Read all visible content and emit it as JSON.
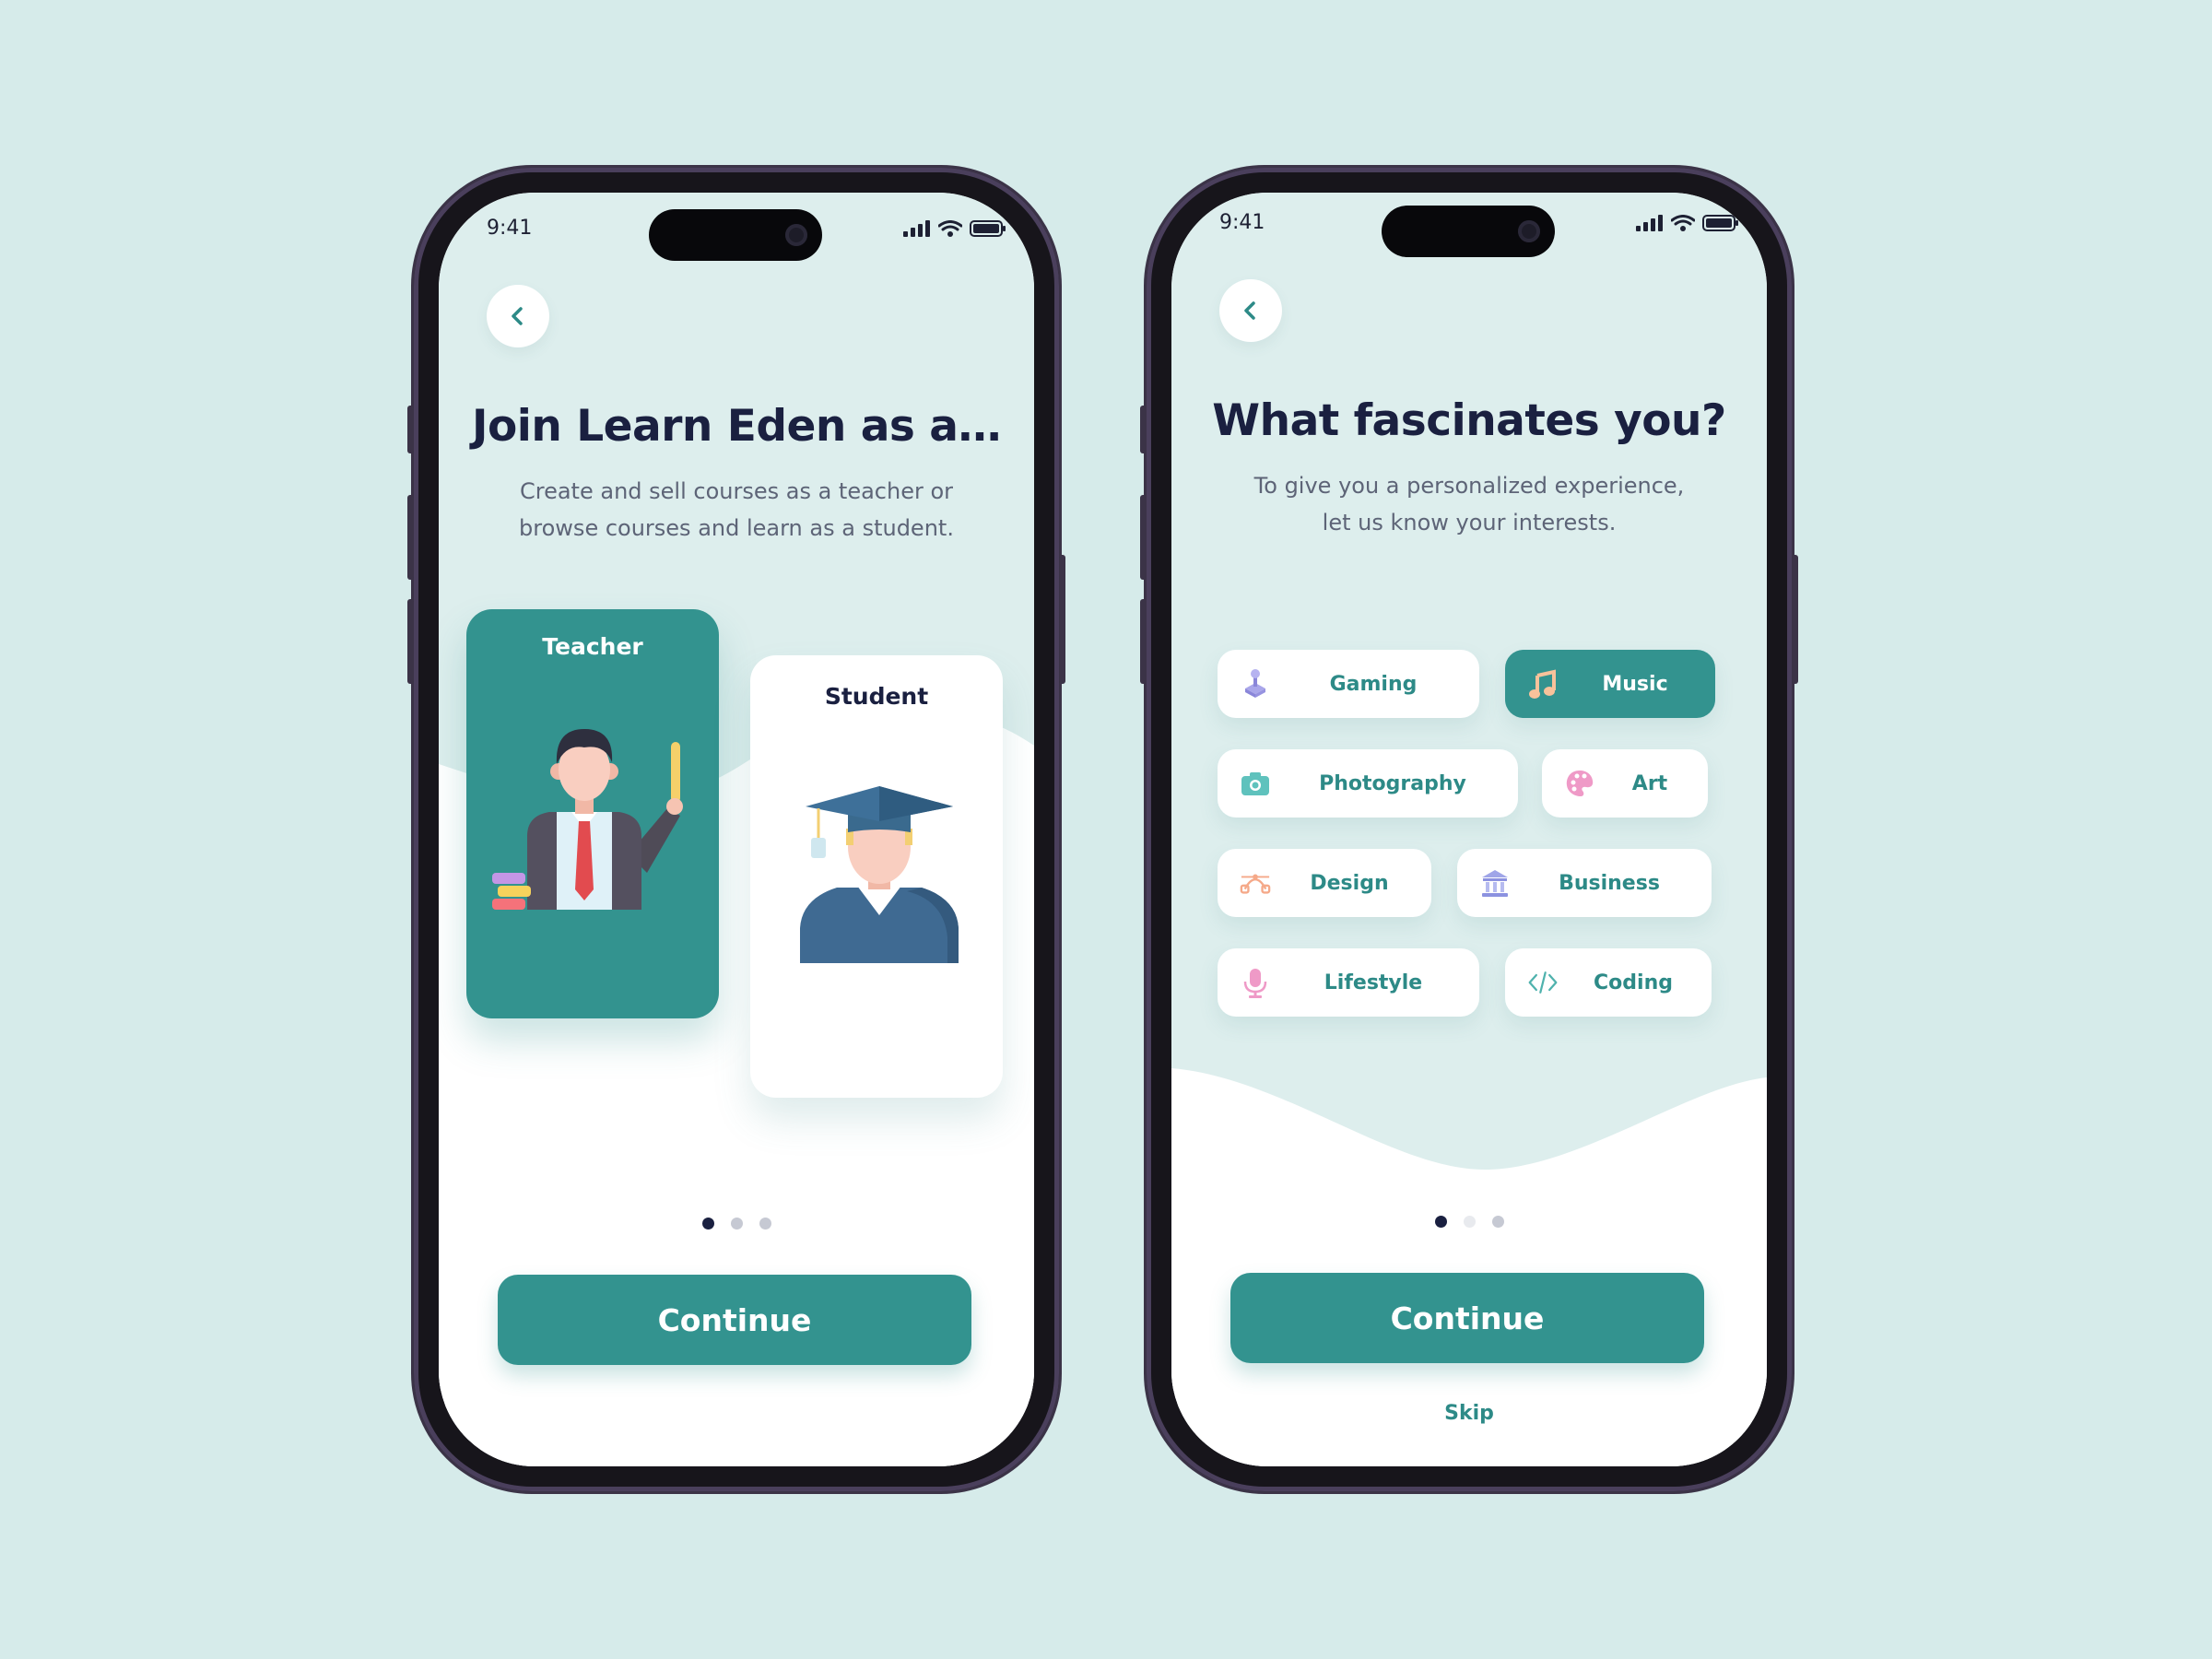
{
  "phone1": {
    "status_time": "9:41",
    "title": "Join Learn Eden as a…",
    "subtitle_line1": "Create and sell courses as a teacher or",
    "subtitle_line2": "browse courses and learn as a student.",
    "cards": [
      {
        "label": "Teacher",
        "icon": "teacher-illustration",
        "selected": true
      },
      {
        "label": "Student",
        "icon": "graduate-student-illustration",
        "selected": false
      }
    ],
    "pagination": {
      "total": 3,
      "active": 1
    },
    "continue_label": "Continue"
  },
  "phone2": {
    "status_time": "9:41",
    "title": "What fascinates you?",
    "subtitle_line1": "To give you a personalized experience,",
    "subtitle_line2": "let us know your interests.",
    "interests": [
      {
        "label": "Gaming",
        "icon": "joystick-icon",
        "selected": false
      },
      {
        "label": "Music",
        "icon": "music-note-icon",
        "selected": true
      },
      {
        "label": "Photography",
        "icon": "camera-icon",
        "selected": false
      },
      {
        "label": "Art",
        "icon": "palette-icon",
        "selected": false
      },
      {
        "label": "Design",
        "icon": "bezier-curve-icon",
        "selected": false
      },
      {
        "label": "Business",
        "icon": "bank-icon",
        "selected": false
      },
      {
        "label": "Lifestyle",
        "icon": "microphone-icon",
        "selected": false
      },
      {
        "label": "Coding",
        "icon": "code-icon",
        "selected": false
      }
    ],
    "pagination": {
      "total": 3,
      "active": 1
    },
    "continue_label": "Continue",
    "skip_label": "Skip"
  },
  "colors": {
    "background": "#d6ebea",
    "accent": "#33938f",
    "title": "#1a2040",
    "screen_tint": "#ddeeed"
  }
}
